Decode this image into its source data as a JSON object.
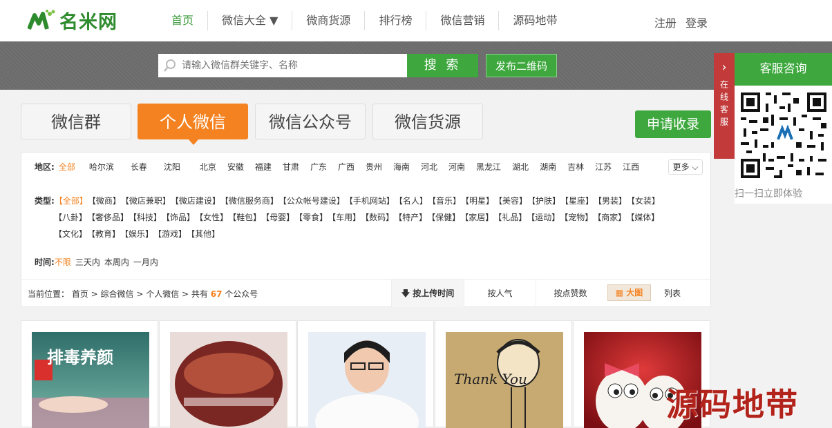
{
  "header": {
    "logo_text": "名米网",
    "nav": [
      "首页",
      "微信大全 ▼",
      "微商货源",
      "排行榜",
      "微信营销",
      "源码地带"
    ],
    "register": "注册",
    "login": "登录"
  },
  "search": {
    "placeholder": "请输入微信群关键字、名称",
    "button": "搜 索",
    "publish": "发布二维码"
  },
  "tabs": [
    "微信群",
    "个人微信",
    "微信公众号",
    "微信货源"
  ],
  "active_tab": "个人微信",
  "apply_button": "申请收录",
  "filter": {
    "region_label": "地区:",
    "regions": [
      "全部",
      "哈尔滨",
      "长春",
      "沈阳",
      "北京",
      "安徽",
      "福建",
      "甘肃",
      "广东",
      "广西",
      "贵州",
      "海南",
      "河北",
      "河南",
      "黑龙江",
      "湖北",
      "湖南",
      "吉林",
      "江苏",
      "江西"
    ],
    "more": "更多",
    "type_label": "类型:",
    "types_line1": [
      "【全部】",
      "【微商】",
      "【微店兼职】",
      "【微店建设】",
      "【微信服务商】",
      "【公众帐号建设】",
      "【手机网站】",
      "【名人】",
      "【音乐】",
      "【明星】",
      "【美容】",
      "【护肤】",
      "【星座】",
      "【男装】",
      "【女装】"
    ],
    "types_line2": [
      "【八卦】",
      "【奢侈品】",
      "【科技】",
      "【饰品】",
      "【女性】",
      "【鞋包】",
      "【母婴】",
      "【零食】",
      "【车用】",
      "【数码】",
      "【特产】",
      "【保健】",
      "【家居】",
      "【礼品】",
      "【运动】",
      "【宠物】",
      "【商家】",
      "【媒体】"
    ],
    "types_line3": [
      "【文化】",
      "【教育】",
      "【娱乐】",
      "【游戏】",
      "【其他】"
    ],
    "time_label": "时间:",
    "times": [
      "不限",
      "三天内",
      "本周内",
      "一月内"
    ]
  },
  "crumb": {
    "prefix": "当前位置：",
    "path": "首页 > 综合微信 > 个人微信 > 共有",
    "count": "67",
    "suffix": "个公众号"
  },
  "sort": {
    "by_time": "按上传时间",
    "by_pop": "按人气",
    "by_likes": "按点赞数",
    "view_big": "大图",
    "view_list": "列表"
  },
  "cards": [
    {
      "caption": "排毒养颜"
    },
    {
      "caption": ""
    },
    {
      "caption": ""
    },
    {
      "caption": "Thank You"
    },
    {
      "caption": ""
    }
  ],
  "side": {
    "tab_text": "在线客服",
    "title": "客服咨询",
    "tip": "扫一扫立即体验"
  },
  "watermark": "源码地带",
  "colors": {
    "green": "#3ea83e",
    "orange": "#f58220",
    "red": "#c23a3a"
  }
}
